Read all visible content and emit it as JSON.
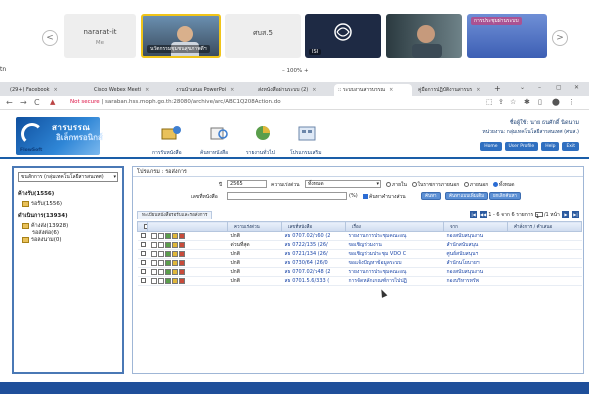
{
  "meeting": {
    "tiles": [
      {
        "name": "nararat-it",
        "sub": "Me"
      },
      {
        "name": "",
        "label": "นวัตกรรมชุมชนสุขภาพดีฯ"
      },
      {
        "name": "ศบส.5",
        "sub": ""
      },
      {
        "name": "",
        "label": "ISI"
      },
      {
        "name": "",
        "label": ""
      },
      {
        "name": "",
        "label": "การประชุมผ่านระบบ"
      }
    ],
    "prev_label": "<",
    "next_label": ">",
    "speaker_initials": "tn",
    "zoom_level": "100%",
    "zoom_minus": "–",
    "zoom_plus": "+"
  },
  "browser": {
    "tabs": [
      {
        "label": "(29+) Facebook"
      },
      {
        "label": "Cisco Webex Meeti"
      },
      {
        "label": "งานนำเสนอ PowerPoi"
      },
      {
        "label": "ส่งหนังสือผ่านระบบ (2)"
      },
      {
        "label": ":: ระบบงานสารบรรณ"
      },
      {
        "label": "คู่มือการปฏิบัติงานสารบร"
      }
    ],
    "new_tab": "+",
    "window_controls": [
      "⌄",
      "–",
      "▢",
      "✕"
    ],
    "nav": [
      "←",
      "→",
      "C"
    ],
    "not_secure": "Not secure",
    "url": "saraban.hss.moph.go.th:28080/archive/arc/ABC1Q208Action.do",
    "tools": [
      "⬚",
      "⇪",
      "☆",
      "✱",
      "▯",
      "⬤",
      "⋮"
    ]
  },
  "app": {
    "logo_title": "สารบรรณ",
    "logo_subtitle": "อิเล็กทรอนิกส์",
    "logo_footer": "FlowSoft",
    "menu": [
      {
        "label": "การรับหนังสือ",
        "icon": "receive-doc-icon"
      },
      {
        "label": "ค้นหาหนังสือ",
        "icon": "search-doc-icon"
      },
      {
        "label": "รายงานทั่วไป",
        "icon": "report-icon"
      },
      {
        "label": "โปรแกรมเสริม",
        "icon": "addon-icon"
      }
    ],
    "user_label": "ชื่อผู้ใช้: นาย ธนศักดิ์ นิดนาม",
    "agency_label": "หน่วยงาน: กลุ่มเทคโนโลยีสารสนเทศ (ศบส.)",
    "header_links": [
      "Home",
      "User Profile",
      "Help",
      "Exit"
    ]
  },
  "sidebar": {
    "selector": "ขนสักการ (กลุ่มเทคโนโลยีสารสนเทศ)",
    "groups": [
      {
        "title": "ค้างรับ(1556)",
        "items": [
          {
            "label": "รอรับ(1556)"
          }
        ]
      },
      {
        "title": "ดำเนินการ(13934)",
        "items": [
          {
            "label": "ค้างส่ง(13928)"
          },
          {
            "label": "รอส่งต่อ(6)"
          },
          {
            "label": "รอลงนาม(0)"
          }
        ]
      }
    ]
  },
  "main": {
    "panel_title": "โปรแกรม : รอส่งการ",
    "year_label": "ปี",
    "year_value": "2565",
    "priority_label": "ความเร่งด่วน",
    "priority_value": "ทั้งหมด",
    "filter_options": [
      {
        "label": "ภายใน",
        "selected": false
      },
      {
        "label": "ในราชการภายนอก",
        "selected": false
      },
      {
        "label": "ภายนอก",
        "selected": false
      },
      {
        "label": "ทั้งหมด",
        "selected": true
      }
    ],
    "book_no_label": "เลขที่หนังสือ",
    "book_no_value": "",
    "percent_label": "(%)",
    "search_all_label": "ค้นหาคำบางส่วน",
    "search_button": "ค้นหา",
    "advanced_button": "ค้นหาแบบเพิ่มเติม",
    "clear_button": "ยกเลิกค้นหา",
    "list_tab": "ทะเบียนหนังสือรอรับและรอส่งการ",
    "pager": {
      "text": "1 - 6 จาก 6 รายการ",
      "page_value": "1",
      "page_total": "/1 หน้า",
      "first": "|◀",
      "prev": "◀◀",
      "next": "▶",
      "last": "▶|"
    },
    "columns": [
      "",
      "",
      "ความเร่งด่วน",
      "เลขที่หนังสือ",
      "เรื่อง",
      "จาก",
      "คำสั่งการ / คำเสนอ"
    ],
    "rows": [
      {
        "priority": "ปกติ",
        "book_no": "สธ 0707.02/ว60 (2",
        "subject": "รายงานการประชุมคณะอนุ",
        "from": "กองสนับสนุนงาน",
        "action": ""
      },
      {
        "priority": "ด่วนที่สุด",
        "book_no": "สธ 0722/135 (26/",
        "subject": "ขอเชิญร่วมงาน",
        "from": "สำนักสนับสนุน",
        "action": ""
      },
      {
        "priority": "ปกติ",
        "book_no": "สธ 0721/134 (26/",
        "subject": "ขอเชิญร่วมประชุม VDO C",
        "from": "ศูนย์สนับสนุนฯ",
        "action": ""
      },
      {
        "priority": "ปกติ",
        "book_no": "สธ 0730/64 (26/0",
        "subject": "ขอแจ้งปัญหาข้อมูลระบบ",
        "from": "สำนักนโยบายฯ",
        "action": ""
      },
      {
        "priority": "ปกติ",
        "book_no": "สธ 0707.02/ว48 (2",
        "subject": "รายงานการประชุมคณะอนุ",
        "from": "กองสนับสนุนงาน",
        "action": ""
      },
      {
        "priority": "ปกติ",
        "book_no": "สธ 0701.5.6/333 (",
        "subject": "การจัดหลักเกณฑ์การไปปฏิ",
        "from": "กองบริหารทรัพ",
        "action": ""
      }
    ]
  },
  "colors": {
    "brand_blue": "#1a5ea8",
    "header_grad_top": "#eaf1fb",
    "link": "#1c47a8"
  }
}
